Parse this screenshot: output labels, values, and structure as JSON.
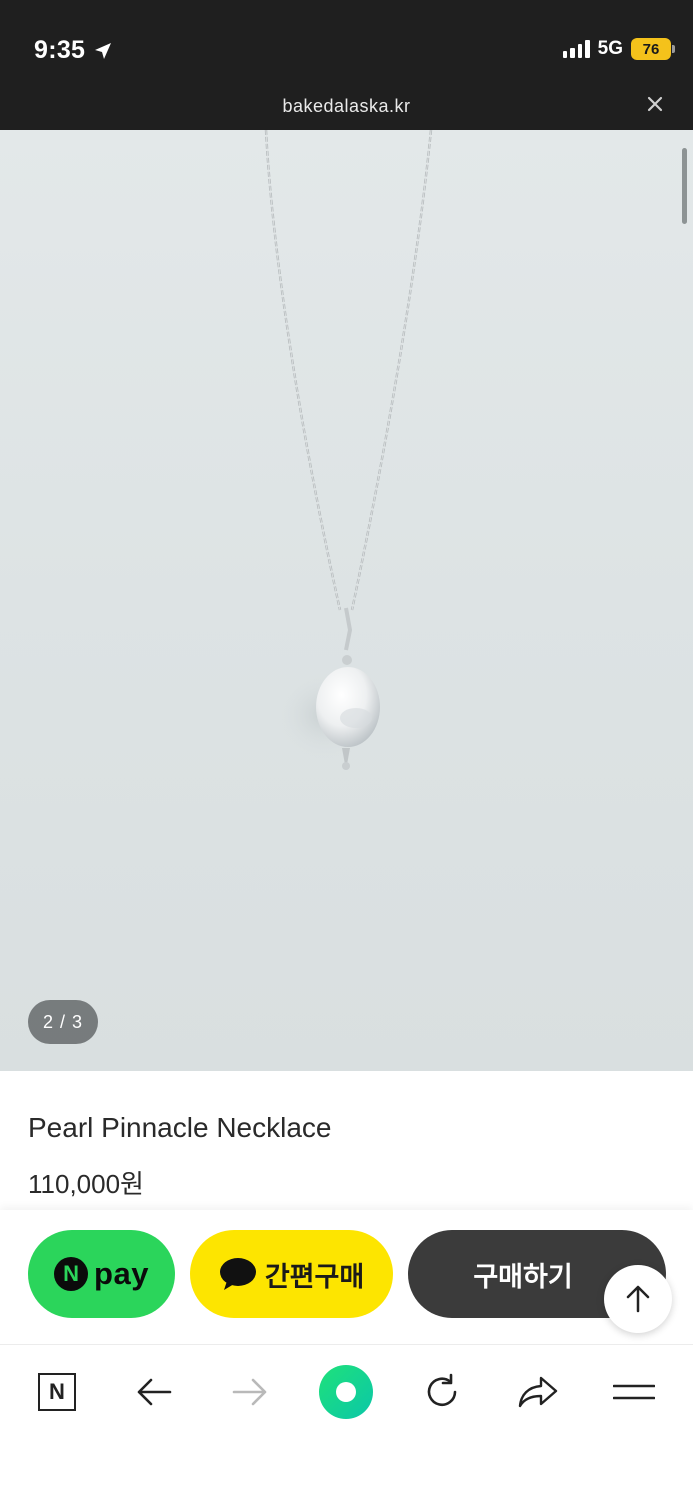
{
  "status_bar": {
    "time": "9:35",
    "network": "5G",
    "battery": "76"
  },
  "browser": {
    "url": "bakedalaska.kr"
  },
  "gallery": {
    "counter": "2 / 3",
    "image_subject": "silver chain necklace with pearl pendant"
  },
  "product": {
    "title": "Pearl Pinnacle Necklace",
    "price": "110,000원"
  },
  "purchase_bar": {
    "npay_n": "N",
    "npay_label": "pay",
    "kakao_label": "간편구매",
    "buy_label": "구매하기"
  },
  "toolbar": {
    "home_logo": "N",
    "icons": [
      "naver-home-icon",
      "back-arrow-icon",
      "forward-arrow-icon",
      "green-dot-icon",
      "reload-icon",
      "share-icon",
      "menu-icon"
    ]
  },
  "colors": {
    "npay_green": "#2bd55b",
    "kakao_yellow": "#fde500",
    "buy_dark": "#3b3b3b",
    "battery_yellow": "#f4c21b"
  }
}
